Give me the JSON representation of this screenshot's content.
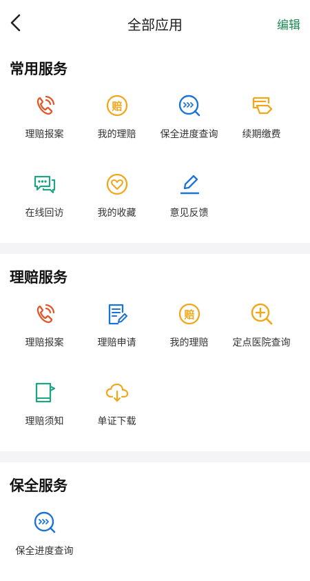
{
  "header": {
    "title": "全部应用",
    "edit_label": "编辑"
  },
  "sections": [
    {
      "title": "常用服务",
      "items": [
        {
          "label": "理赔报案",
          "icon": "phone-icon",
          "color": "#e2562b"
        },
        {
          "label": "我的理赔",
          "icon": "claim-coin-icon",
          "color": "#f2a71b"
        },
        {
          "label": "保全进度查询",
          "icon": "progress-search-icon",
          "color": "#1a73d9"
        },
        {
          "label": "续期缴费",
          "icon": "payment-icon",
          "color": "#f2a71b"
        },
        {
          "label": "在线回访",
          "icon": "chat-icon",
          "color": "#1fa383"
        },
        {
          "label": "我的收藏",
          "icon": "heart-icon",
          "color": "#f2a71b"
        },
        {
          "label": "意见反馈",
          "icon": "pen-icon",
          "color": "#1a73d9"
        }
      ]
    },
    {
      "title": "理赔服务",
      "items": [
        {
          "label": "理赔报案",
          "icon": "phone-icon",
          "color": "#e2562b"
        },
        {
          "label": "理赔申请",
          "icon": "document-edit-icon",
          "color": "#1a73d9"
        },
        {
          "label": "我的理赔",
          "icon": "claim-coin-icon",
          "color": "#f2a71b"
        },
        {
          "label": "定点医院查询",
          "icon": "hospital-search-icon",
          "color": "#f2a71b"
        },
        {
          "label": "理赔须知",
          "icon": "notice-book-icon",
          "color": "#1fa383"
        },
        {
          "label": "单证下载",
          "icon": "cloud-download-icon",
          "color": "#f2a71b"
        }
      ]
    },
    {
      "title": "保全服务",
      "items": [
        {
          "label": "保全进度查询",
          "icon": "progress-search-icon",
          "color": "#1a73d9"
        }
      ]
    }
  ]
}
